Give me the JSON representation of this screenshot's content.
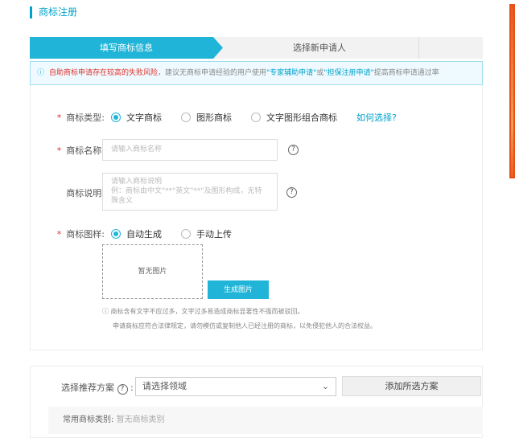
{
  "page": {
    "title": "商标注册"
  },
  "steps": [
    {
      "label": "填写商标信息",
      "active": true
    },
    {
      "label": "选择新申请人",
      "active": false
    }
  ],
  "notice": {
    "warning": "自助商标申请存在较高的失败风险",
    "text1": "，建议无商标申请经验的用户使用",
    "link1": "\"专家辅助申请\"",
    "or": "或",
    "link2": "\"担保注册申请\"",
    "text2": "提高商标申请通过率"
  },
  "form": {
    "type": {
      "label": "商标类型:",
      "options": [
        "文字商标",
        "图形商标",
        "文字图形组合商标"
      ],
      "selected": "文字商标",
      "help_link": "如何选择?"
    },
    "name": {
      "label": "商标名称:",
      "placeholder": "请输入商标名称"
    },
    "desc": {
      "label": "商标说明:",
      "placeholder_line1": "请输入商标说明",
      "placeholder_line2": "例：商标由中文\"**\"英文\"**\"及图形构成，无特殊含义"
    },
    "pattern": {
      "label": "商标图样:",
      "options": [
        "自动生成",
        "手动上传"
      ],
      "selected": "自动生成",
      "empty_image": "暂无图片",
      "generate_button": "生成图片"
    },
    "notes": [
      "商标含有文字不应过多，文字过多易造成商标显著性不强而被驳回。",
      "申请商标应符合法律规定，请勿模仿或复制他人已经注册的商标，以免侵犯他人的合法权益。"
    ]
  },
  "recommend": {
    "label": "选择推荐方案",
    "select_value": "请选择领域",
    "add_button": "添加所选方案",
    "common_label": "常用商标类别:",
    "common_value": "暂无商标类别"
  },
  "colors": {
    "accent": "#20b5d8",
    "required": "#e0312c"
  }
}
